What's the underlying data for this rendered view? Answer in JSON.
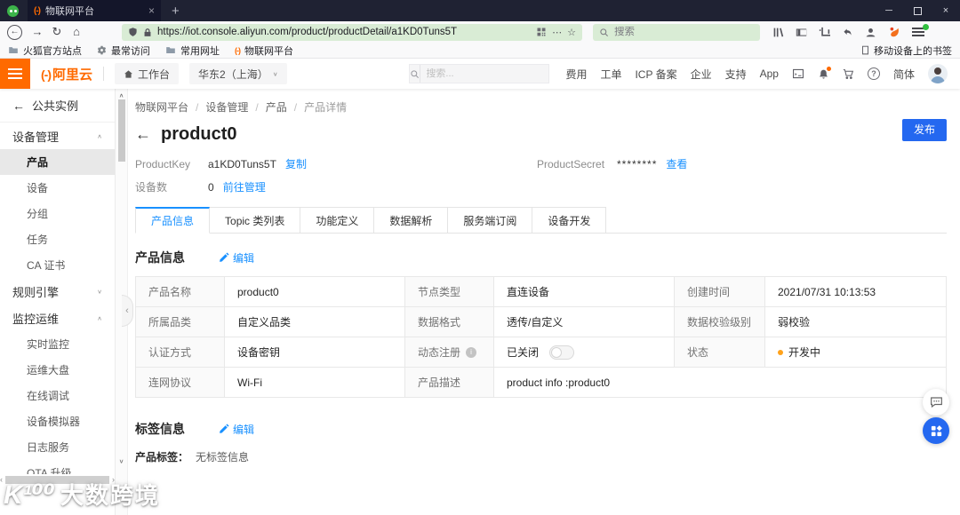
{
  "browser": {
    "tab_title": "物联网平台",
    "url": "https://iot.console.aliyun.com/product/productDetail/a1KD0Tuns5T",
    "search_placeholder": "搜索",
    "bookmarks": {
      "firefox_official": "火狐官方站点",
      "most_visited": "最常访问",
      "common_sites": "常用网址",
      "iot_platform": "物联网平台",
      "mobile_bookmarks": "移动设备上的书签"
    }
  },
  "console_header": {
    "logo_mark": "(-)",
    "logo_text": "阿里云",
    "workbench": "工作台",
    "region": "华东2（上海）",
    "search_placeholder": "搜索...",
    "nav_items": [
      "费用",
      "工单",
      "ICP 备案",
      "企业",
      "支持",
      "App"
    ],
    "lang": "简体"
  },
  "sidebar": {
    "back_label": "公共实例",
    "active_item": "产品",
    "groups": {
      "device": {
        "label": "设备管理",
        "items": [
          "产品",
          "设备",
          "分组",
          "任务",
          "CA 证书"
        ]
      },
      "rules": {
        "label": "规则引擎"
      },
      "monitor": {
        "label": "监控运维",
        "items": [
          "实时监控",
          "运维大盘",
          "在线调试",
          "设备模拟器",
          "日志服务",
          "OTA 升级"
        ]
      }
    }
  },
  "page": {
    "breadcrumb": [
      "物联网平台",
      "设备管理",
      "产品",
      "产品详情"
    ],
    "title": "product0",
    "publish": "发布",
    "meta": {
      "product_key_label": "ProductKey",
      "product_key": "a1KD0Tuns5T",
      "copy": "复制",
      "product_secret_label": "ProductSecret",
      "product_secret": "********",
      "view": "查看",
      "device_count_label": "设备数",
      "device_count": "0",
      "manage": "前往管理"
    },
    "tabs": [
      "产品信息",
      "Topic 类列表",
      "功能定义",
      "数据解析",
      "服务端订阅",
      "设备开发"
    ],
    "product_info": {
      "heading": "产品信息",
      "edit": "编辑"
    },
    "table": {
      "r1": {
        "l1": "产品名称",
        "v1": "product0",
        "l2": "节点类型",
        "v2": "直连设备",
        "l3": "创建时间",
        "v3": "2021/07/31 10:13:53"
      },
      "r2": {
        "l1": "所属品类",
        "v1": "自定义品类",
        "l2": "数据格式",
        "v2": "透传/自定义",
        "l3": "数据校验级别",
        "v3": "弱校验"
      },
      "r3": {
        "l1": "认证方式",
        "v1": "设备密钥",
        "l2": "动态注册",
        "v2": "已关闭",
        "l3": "状态",
        "v3": "开发中"
      },
      "r4": {
        "l1": "连网协议",
        "v1": "Wi-Fi",
        "l2": "产品描述",
        "v2": "product info :product0"
      }
    },
    "tag_info": {
      "heading": "标签信息",
      "edit": "编辑",
      "label": "产品标签：",
      "value": "无标签信息"
    }
  },
  "watermark": {
    "mark": "K¹⁰⁰",
    "text": "大数跨境"
  },
  "colors": {
    "aliyun_orange": "#ff6a00",
    "link_blue": "#1890ff",
    "publish_button_blue": "#2468f0",
    "status_dev_orange": "#ffa21a",
    "urlbar_green": "#d9ecd5",
    "titlebar_dark": "#1f2233"
  }
}
